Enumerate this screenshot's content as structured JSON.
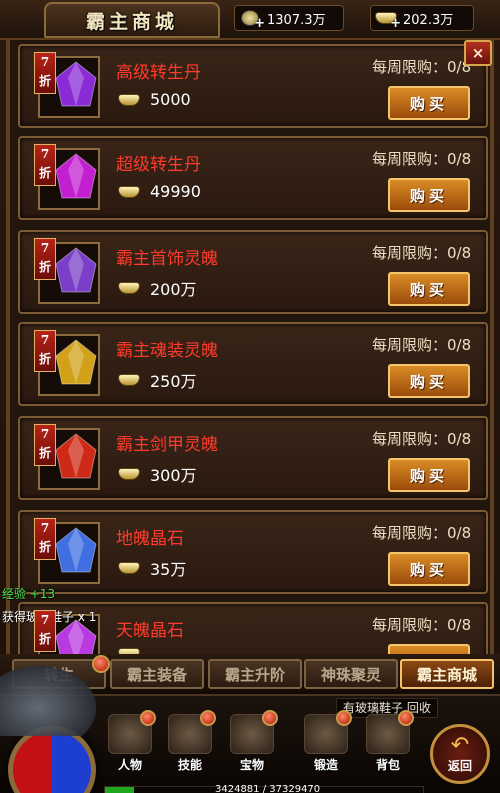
{
  "header": {
    "title": "霸主商城",
    "copper": "1307.3万",
    "gold": "202.3万"
  },
  "close_label": "×",
  "items": [
    {
      "discount": "7折",
      "name": "高级转生丹",
      "price": "5000",
      "limit": "每周限购：0/8",
      "buy": "购买",
      "gem_color": "#8a2bd6"
    },
    {
      "discount": "7折",
      "name": "超级转生丹",
      "price": "49990",
      "limit": "每周限购：0/8",
      "buy": "购买",
      "gem_color": "#c21fd0"
    },
    {
      "discount": "7折",
      "name": "霸主首饰灵魄",
      "price": "200万",
      "limit": "每周限购：0/8",
      "buy": "购买",
      "gem_color": "#7a3ec8"
    },
    {
      "discount": "7折",
      "name": "霸主魂装灵魄",
      "price": "250万",
      "limit": "每周限购：0/8",
      "buy": "购买",
      "gem_color": "#d1a11a"
    },
    {
      "discount": "7折",
      "name": "霸主剑甲灵魄",
      "price": "300万",
      "limit": "每周限购：0/8",
      "buy": "购买",
      "gem_color": "#cf2a17"
    },
    {
      "discount": "7折",
      "name": "地魄晶石",
      "price": "35万",
      "limit": "每周限购：0/8",
      "buy": "购买",
      "gem_color": "#3f6fe0"
    },
    {
      "discount": "7折",
      "name": "天魄晶石",
      "price": "",
      "limit": "每周限购：0/8",
      "buy": "购买",
      "gem_color": "#b83ae0"
    }
  ],
  "messages": {
    "exp": "经验 +13",
    "gain": "获得玻璃鞋子 x 1"
  },
  "tabs": [
    {
      "label": "转生",
      "active": false,
      "dot": true
    },
    {
      "label": "霸主装备",
      "active": false,
      "dot": false
    },
    {
      "label": "霸主升阶",
      "active": false,
      "dot": false
    },
    {
      "label": "神珠聚灵",
      "active": false,
      "dot": false
    },
    {
      "label": "霸主商城",
      "active": true,
      "dot": false
    }
  ],
  "hud": {
    "tip": "有玻璃鞋子,回收",
    "menu": [
      "人物",
      "技能",
      "宝物",
      "锻造",
      "背包"
    ],
    "return_label": "返回",
    "exp_text": "3424881 / 37329470",
    "exp_progress": 0.0917
  }
}
